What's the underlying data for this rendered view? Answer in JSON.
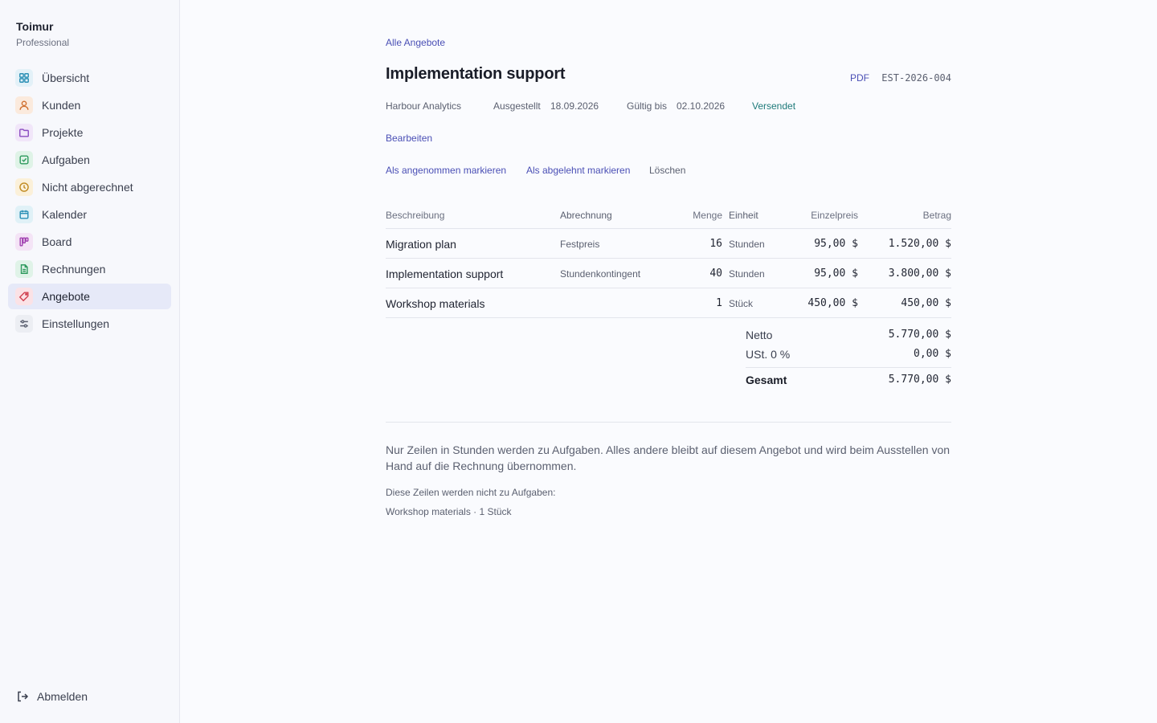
{
  "sidebar": {
    "brand": "Toimur",
    "plan": "Professional",
    "items": [
      {
        "label": "Übersicht",
        "icon": "grid-icon",
        "color": "#2a8fb5",
        "bg": "#e3f1f8"
      },
      {
        "label": "Kunden",
        "icon": "user-icon",
        "color": "#d07030",
        "bg": "#fbeadd"
      },
      {
        "label": "Projekte",
        "icon": "folder-icon",
        "color": "#8a4cc0",
        "bg": "#f1e6f9"
      },
      {
        "label": "Aufgaben",
        "icon": "checkbox-icon",
        "color": "#2e9a5e",
        "bg": "#dff3e7"
      },
      {
        "label": "Nicht abgerechnet",
        "icon": "clock-icon",
        "color": "#c08a20",
        "bg": "#fbf0d9"
      },
      {
        "label": "Kalender",
        "icon": "calendar-icon",
        "color": "#2a8fb5",
        "bg": "#e0f1f7"
      },
      {
        "label": "Board",
        "icon": "board-icon",
        "color": "#a040b0",
        "bg": "#f4e4f6"
      },
      {
        "label": "Rechnungen",
        "icon": "document-icon",
        "color": "#2e9a5e",
        "bg": "#e0f3e8"
      },
      {
        "label": "Angebote",
        "icon": "tag-icon",
        "color": "#d04050",
        "bg": "#fbe2e6"
      },
      {
        "label": "Einstellungen",
        "icon": "sliders-icon",
        "color": "#5b6070",
        "bg": "#eceef3"
      }
    ],
    "active": "Angebote",
    "logout": "Abmelden"
  },
  "header": {
    "breadcrumb": "Alle Angebote",
    "title": "Implementation support",
    "pdf": "PDF",
    "number": "EST-2026-004"
  },
  "meta": {
    "client": "Harbour Analytics",
    "issued_label": "Ausgestellt",
    "issued": "18.09.2026",
    "valid_label": "Gültig bis",
    "valid": "02.10.2026",
    "status": "Versendet"
  },
  "actions": {
    "edit": "Bearbeiten",
    "accept": "Als angenommen markieren",
    "reject": "Als abgelehnt markieren",
    "delete": "Löschen"
  },
  "table": {
    "headers": {
      "description": "Beschreibung",
      "billing": "Abrechnung",
      "quantity": "Menge",
      "unit": "Einheit",
      "unit_price": "Einzelpreis",
      "amount": "Betrag"
    },
    "rows": [
      {
        "description": "Migration plan",
        "billing": "Festpreis",
        "quantity": "16",
        "unit": "Stunden",
        "unit_price": "95,00 $",
        "amount": "1.520,00 $"
      },
      {
        "description": "Implementation support",
        "billing": "Stundenkontingent",
        "quantity": "40",
        "unit": "Stunden",
        "unit_price": "95,00 $",
        "amount": "3.800,00 $"
      },
      {
        "description": "Workshop materials",
        "billing": "",
        "quantity": "1",
        "unit": "Stück",
        "unit_price": "450,00 $",
        "amount": "450,00 $"
      }
    ]
  },
  "totals": {
    "net_label": "Netto",
    "net": "5.770,00 $",
    "tax_label": "USt. 0 %",
    "tax": "0,00 $",
    "total_label": "Gesamt",
    "total": "5.770,00 $"
  },
  "note": {
    "text": "Nur Zeilen in Stunden werden zu Aufgaben. Alles andere bleibt auf diesem Angebot und wird beim Ausstellen von Hand auf die Rechnung übernommen.",
    "sub": "Diese Zeilen werden nicht zu Aufgaben:",
    "item": "Workshop materials · 1 Stück"
  }
}
